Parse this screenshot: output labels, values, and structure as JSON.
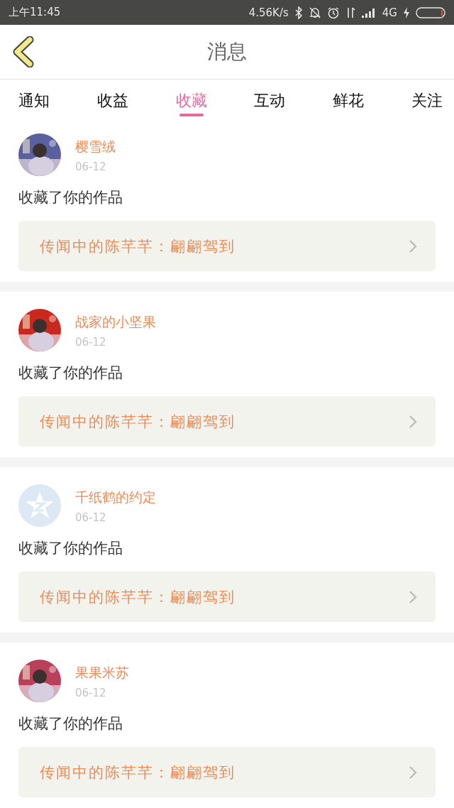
{
  "status_bar": {
    "time": "上午11:45",
    "speed": "4.56K/s",
    "network": "4G"
  },
  "header": {
    "title": "消息"
  },
  "tabs": [
    {
      "label": "通知",
      "selected": false
    },
    {
      "label": "收益",
      "selected": false
    },
    {
      "label": "收藏",
      "selected": true
    },
    {
      "label": "互动",
      "selected": false
    },
    {
      "label": "鲜花",
      "selected": false
    },
    {
      "label": "关注",
      "selected": false
    }
  ],
  "items": [
    {
      "name": "樱雪绒",
      "date": "06-12",
      "action": "收藏了你的作品",
      "work": "传闻中的陈芊芊：翩翩驾到"
    },
    {
      "name": "战家的小坚果",
      "date": "06-12",
      "action": "收藏了你的作品",
      "work": "传闻中的陈芊芊：翩翩驾到"
    },
    {
      "avatar": {
        "kind": "default",
        "color": "#dce8f4"
      },
      "name": "千纸鹤的约定",
      "date": "06-12",
      "action": "收藏了你的作品",
      "work": "传闻中的陈芊芊：翩翩驾到"
    },
    {
      "name": "果果米苏",
      "date": "06-12",
      "action": "收藏了你的作品",
      "work": "传闻中的陈芊芊：翩翩驾到"
    }
  ]
}
